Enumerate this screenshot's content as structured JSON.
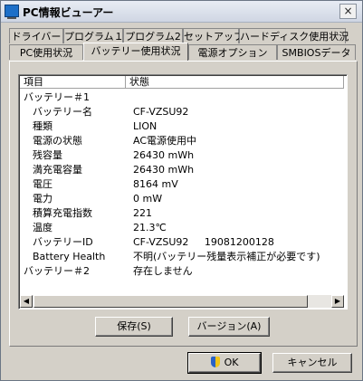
{
  "window": {
    "title": "PC情報ビューアー",
    "close": "×"
  },
  "tabs_row1": [
    "ドライバー",
    "プログラム１",
    "プログラム2",
    "セットアップ",
    "ハードディスク使用状況"
  ],
  "tabs_row2": [
    "PC使用状況",
    "バッテリー使用状況",
    "電源オプション",
    "SMBIOSデータ"
  ],
  "active_tab": "バッテリー使用状況",
  "list": {
    "headers": [
      "項目",
      "状態"
    ],
    "rows": [
      {
        "key": "バッテリー＃1",
        "value": "",
        "indent": false
      },
      {
        "key": "バッテリー名",
        "value": "CF-VZSU92",
        "indent": true
      },
      {
        "key": "種類",
        "value": "LION",
        "indent": true
      },
      {
        "key": "電源の状態",
        "value": "AC電源使用中",
        "indent": true
      },
      {
        "key": "残容量",
        "value": "26430 mWh",
        "indent": true
      },
      {
        "key": "満充電容量",
        "value": "26430 mWh",
        "indent": true
      },
      {
        "key": "電圧",
        "value": "8164 mV",
        "indent": true
      },
      {
        "key": "電力",
        "value": "0 mW",
        "indent": true
      },
      {
        "key": "積算充電指数",
        "value": "221",
        "indent": true
      },
      {
        "key": "温度",
        "value": "21.3℃",
        "indent": true
      },
      {
        "key": "バッテリーID",
        "value": "CF-VZSU92     19081200128",
        "indent": true
      },
      {
        "key": "Battery Health",
        "value": "不明(バッテリー残量表示補正が必要です)",
        "indent": true
      },
      {
        "key": "バッテリー＃2",
        "value": "存在しません",
        "indent": false
      }
    ]
  },
  "buttons": {
    "save": "保存(S)",
    "version": "バージョン(A)",
    "ok": "OK",
    "cancel": "キャンセル"
  },
  "colors": {
    "window_bg": "#d4d0c8",
    "title_bg": "#dde3ee"
  }
}
